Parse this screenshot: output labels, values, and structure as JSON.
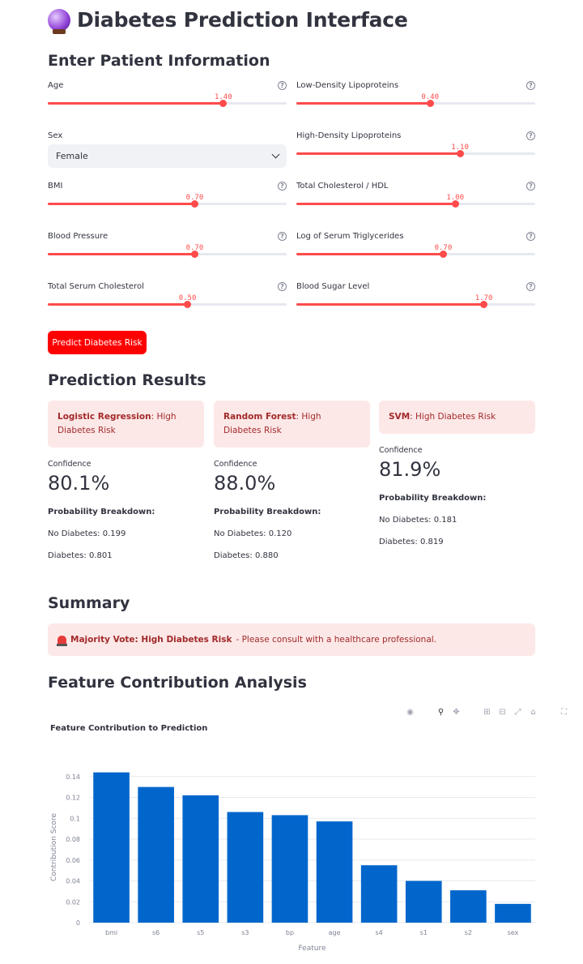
{
  "app": {
    "title": "Diabetes Prediction Interface",
    "title_icon": "crystal-ball-icon"
  },
  "inputs": {
    "heading": "Enter Patient Information",
    "sliders": [
      {
        "id": "age",
        "label": "Age",
        "value_text": "1.40",
        "fraction": 0.735,
        "column": "left",
        "row": 0
      },
      {
        "id": "ldl",
        "label": "Low-Density Lipoproteins",
        "value_text": "0.40",
        "fraction": 0.56,
        "column": "right",
        "row": 0
      },
      {
        "id": "hdl",
        "label": "High-Density Lipoproteins",
        "value_text": "1.10",
        "fraction": 0.685,
        "column": "right",
        "row": 1
      },
      {
        "id": "bmi",
        "label": "BMI",
        "value_text": "0.70",
        "fraction": 0.615,
        "column": "left",
        "row": 2
      },
      {
        "id": "tch",
        "label": "Total Cholesterol / HDL",
        "value_text": "1.00",
        "fraction": 0.665,
        "column": "right",
        "row": 2
      },
      {
        "id": "bp",
        "label": "Blood Pressure",
        "value_text": "0.70",
        "fraction": 0.615,
        "column": "left",
        "row": 3
      },
      {
        "id": "ltg",
        "label": "Log of Serum Triglycerides",
        "value_text": "0.70",
        "fraction": 0.615,
        "column": "right",
        "row": 3
      },
      {
        "id": "tc",
        "label": "Total Serum Cholesterol",
        "value_text": "0.50",
        "fraction": 0.585,
        "column": "left",
        "row": 4
      },
      {
        "id": "glu",
        "label": "Blood Sugar Level",
        "value_text": "1.70",
        "fraction": 0.785,
        "column": "right",
        "row": 4
      }
    ],
    "sex": {
      "label": "Sex",
      "selected": "Female"
    },
    "predict_button": "Predict Diabetes Risk"
  },
  "results": {
    "heading": "Prediction Results",
    "confidence_label": "Confidence",
    "breakdown_title": "Probability Breakdown:",
    "models": [
      {
        "name": "Logistic Regression",
        "verdict": ": High Diabetes Risk",
        "confidence": "80.1%",
        "no_diabetes": "No Diabetes: 0.199",
        "diabetes": "Diabetes: 0.801"
      },
      {
        "name": "Random Forest",
        "verdict": ": High Diabetes Risk",
        "confidence": "88.0%",
        "no_diabetes": "No Diabetes: 0.120",
        "diabetes": "Diabetes: 0.880"
      },
      {
        "name": "SVM",
        "verdict": ": High Diabetes Risk",
        "confidence": "81.9%",
        "no_diabetes": "No Diabetes: 0.181",
        "diabetes": "Diabetes: 0.819"
      }
    ]
  },
  "summary": {
    "heading": "Summary",
    "bold": "Majority Vote: High Diabetes Risk",
    "rest": " - Please consult with a healthcare professional."
  },
  "features": {
    "heading": "Feature Contribution Analysis"
  },
  "chart_data": {
    "type": "bar",
    "title": "Feature Contribution to Prediction",
    "xlabel": "Feature",
    "ylabel": "Contribution Score",
    "categories": [
      "bmi",
      "s6",
      "s5",
      "s3",
      "bp",
      "age",
      "s4",
      "s1",
      "s2",
      "sex"
    ],
    "values": [
      0.144,
      0.13,
      0.122,
      0.106,
      0.103,
      0.097,
      0.055,
      0.04,
      0.031,
      0.018
    ],
    "ylim": [
      0,
      0.1445
    ],
    "yticks": [
      0,
      0.02,
      0.04,
      0.06,
      0.08,
      0.1,
      0.12,
      0.14
    ],
    "ytick_labels": [
      "0",
      "0.02",
      "0.04",
      "0.06",
      "0.08",
      "0.1",
      "0.12",
      "0.14"
    ],
    "color": "#0066cc",
    "grid": true
  },
  "colors": {
    "accent": "#ff4b4b",
    "button": "#ff0000",
    "alert_bg": "#fde8e8",
    "alert_text": "#a22a2a",
    "bar": "#0066cc"
  }
}
